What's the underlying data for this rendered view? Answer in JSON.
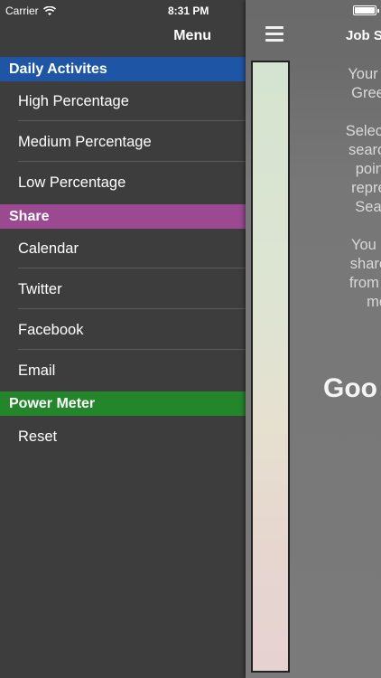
{
  "status_bar": {
    "carrier": "Carrier",
    "time": "8:31 PM"
  },
  "menu": {
    "title": "Menu",
    "sections": [
      {
        "label": "Daily Activites",
        "color": "#1f55a5",
        "items": [
          "High Percentage",
          "Medium Percentage",
          "Low Percentage"
        ]
      },
      {
        "label": "Share",
        "color": "#9b4a92",
        "items": [
          "Calendar",
          "Twitter",
          "Facebook",
          "Email"
        ]
      },
      {
        "label": "Power Meter",
        "color": "#24862b",
        "items": [
          "Reset"
        ]
      }
    ]
  },
  "panel": {
    "title": "Job S",
    "paragraphs": [
      [
        "Your goal i",
        "Green Zo"
      ],
      [
        "Selecting fr",
        "search act",
        "points w",
        "represent",
        "Search I"
      ],
      [
        "You are e",
        "share you",
        "from the a",
        "medi"
      ]
    ],
    "status_word": "Goo"
  }
}
